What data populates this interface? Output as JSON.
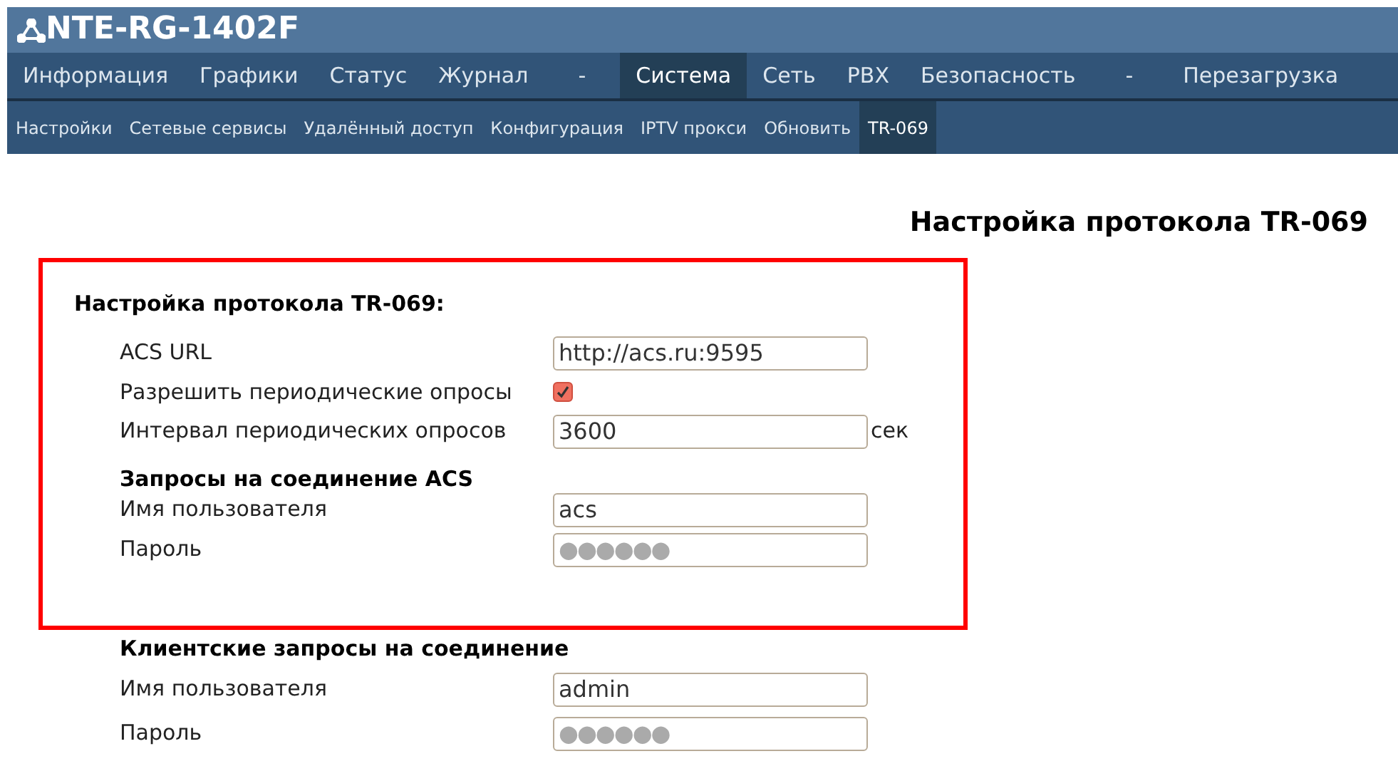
{
  "header": {
    "title": "NTE-RG-1402F"
  },
  "main_menu": [
    {
      "label": "Информация",
      "selected": false
    },
    {
      "label": "Графики",
      "selected": false
    },
    {
      "label": "Статус",
      "selected": false
    },
    {
      "label": "Журнал",
      "selected": false
    },
    {
      "label": "-",
      "selected": false
    },
    {
      "label": "Система",
      "selected": true
    },
    {
      "label": "Сеть",
      "selected": false
    },
    {
      "label": "PBX",
      "selected": false
    },
    {
      "label": "Безопасность",
      "selected": false
    },
    {
      "label": "-",
      "selected": false
    },
    {
      "label": "Перезагрузка",
      "selected": false
    }
  ],
  "sub_menu": [
    {
      "label": "Настройки",
      "selected": false
    },
    {
      "label": "Сетевые сервисы",
      "selected": false
    },
    {
      "label": "Удалённый доступ",
      "selected": false
    },
    {
      "label": "Конфигурация",
      "selected": false
    },
    {
      "label": "IPTV прокси",
      "selected": false
    },
    {
      "label": "Обновить",
      "selected": false
    },
    {
      "label": "TR-069",
      "selected": true
    }
  ],
  "page_title": "Настройка протокола TR-069",
  "highlighted_section": {
    "title": "Настройка протокола TR-069:",
    "rows": [
      {
        "kind": "text",
        "label": "ACS URL",
        "value": "http://acs.ru:9595"
      },
      {
        "kind": "checkbox",
        "label": "Разрешить периодические опросы",
        "checked": true
      },
      {
        "kind": "text",
        "label": "Интервал периодических опросов",
        "value": "3600",
        "unit": "сек"
      },
      {
        "kind": "subheading",
        "label": "Запросы на соединение ACS"
      },
      {
        "kind": "text",
        "label": "Имя пользователя",
        "value": "acs"
      },
      {
        "kind": "password",
        "label": "Пароль",
        "value": "●●●●●●"
      }
    ]
  },
  "client_section": {
    "title": "Клиентские запросы на соединение",
    "rows": [
      {
        "kind": "text",
        "label": "Имя пользователя",
        "value": "admin"
      },
      {
        "kind": "password",
        "label": "Пароль",
        "value": "●●●●●●"
      }
    ]
  }
}
